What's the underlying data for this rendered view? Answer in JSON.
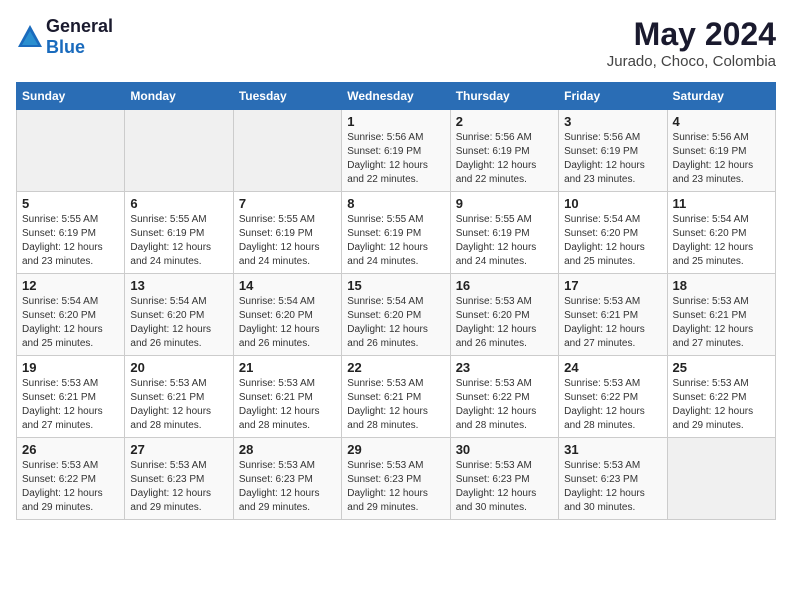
{
  "header": {
    "logo_general": "General",
    "logo_blue": "Blue",
    "month_year": "May 2024",
    "location": "Jurado, Choco, Colombia"
  },
  "days_of_week": [
    "Sunday",
    "Monday",
    "Tuesday",
    "Wednesday",
    "Thursday",
    "Friday",
    "Saturday"
  ],
  "weeks": [
    [
      {
        "day": "",
        "info": ""
      },
      {
        "day": "",
        "info": ""
      },
      {
        "day": "",
        "info": ""
      },
      {
        "day": "1",
        "info": "Sunrise: 5:56 AM\nSunset: 6:19 PM\nDaylight: 12 hours\nand 22 minutes."
      },
      {
        "day": "2",
        "info": "Sunrise: 5:56 AM\nSunset: 6:19 PM\nDaylight: 12 hours\nand 22 minutes."
      },
      {
        "day": "3",
        "info": "Sunrise: 5:56 AM\nSunset: 6:19 PM\nDaylight: 12 hours\nand 23 minutes."
      },
      {
        "day": "4",
        "info": "Sunrise: 5:56 AM\nSunset: 6:19 PM\nDaylight: 12 hours\nand 23 minutes."
      }
    ],
    [
      {
        "day": "5",
        "info": "Sunrise: 5:55 AM\nSunset: 6:19 PM\nDaylight: 12 hours\nand 23 minutes."
      },
      {
        "day": "6",
        "info": "Sunrise: 5:55 AM\nSunset: 6:19 PM\nDaylight: 12 hours\nand 24 minutes."
      },
      {
        "day": "7",
        "info": "Sunrise: 5:55 AM\nSunset: 6:19 PM\nDaylight: 12 hours\nand 24 minutes."
      },
      {
        "day": "8",
        "info": "Sunrise: 5:55 AM\nSunset: 6:19 PM\nDaylight: 12 hours\nand 24 minutes."
      },
      {
        "day": "9",
        "info": "Sunrise: 5:55 AM\nSunset: 6:19 PM\nDaylight: 12 hours\nand 24 minutes."
      },
      {
        "day": "10",
        "info": "Sunrise: 5:54 AM\nSunset: 6:20 PM\nDaylight: 12 hours\nand 25 minutes."
      },
      {
        "day": "11",
        "info": "Sunrise: 5:54 AM\nSunset: 6:20 PM\nDaylight: 12 hours\nand 25 minutes."
      }
    ],
    [
      {
        "day": "12",
        "info": "Sunrise: 5:54 AM\nSunset: 6:20 PM\nDaylight: 12 hours\nand 25 minutes."
      },
      {
        "day": "13",
        "info": "Sunrise: 5:54 AM\nSunset: 6:20 PM\nDaylight: 12 hours\nand 26 minutes."
      },
      {
        "day": "14",
        "info": "Sunrise: 5:54 AM\nSunset: 6:20 PM\nDaylight: 12 hours\nand 26 minutes."
      },
      {
        "day": "15",
        "info": "Sunrise: 5:54 AM\nSunset: 6:20 PM\nDaylight: 12 hours\nand 26 minutes."
      },
      {
        "day": "16",
        "info": "Sunrise: 5:53 AM\nSunset: 6:20 PM\nDaylight: 12 hours\nand 26 minutes."
      },
      {
        "day": "17",
        "info": "Sunrise: 5:53 AM\nSunset: 6:21 PM\nDaylight: 12 hours\nand 27 minutes."
      },
      {
        "day": "18",
        "info": "Sunrise: 5:53 AM\nSunset: 6:21 PM\nDaylight: 12 hours\nand 27 minutes."
      }
    ],
    [
      {
        "day": "19",
        "info": "Sunrise: 5:53 AM\nSunset: 6:21 PM\nDaylight: 12 hours\nand 27 minutes."
      },
      {
        "day": "20",
        "info": "Sunrise: 5:53 AM\nSunset: 6:21 PM\nDaylight: 12 hours\nand 28 minutes."
      },
      {
        "day": "21",
        "info": "Sunrise: 5:53 AM\nSunset: 6:21 PM\nDaylight: 12 hours\nand 28 minutes."
      },
      {
        "day": "22",
        "info": "Sunrise: 5:53 AM\nSunset: 6:21 PM\nDaylight: 12 hours\nand 28 minutes."
      },
      {
        "day": "23",
        "info": "Sunrise: 5:53 AM\nSunset: 6:22 PM\nDaylight: 12 hours\nand 28 minutes."
      },
      {
        "day": "24",
        "info": "Sunrise: 5:53 AM\nSunset: 6:22 PM\nDaylight: 12 hours\nand 28 minutes."
      },
      {
        "day": "25",
        "info": "Sunrise: 5:53 AM\nSunset: 6:22 PM\nDaylight: 12 hours\nand 29 minutes."
      }
    ],
    [
      {
        "day": "26",
        "info": "Sunrise: 5:53 AM\nSunset: 6:22 PM\nDaylight: 12 hours\nand 29 minutes."
      },
      {
        "day": "27",
        "info": "Sunrise: 5:53 AM\nSunset: 6:23 PM\nDaylight: 12 hours\nand 29 minutes."
      },
      {
        "day": "28",
        "info": "Sunrise: 5:53 AM\nSunset: 6:23 PM\nDaylight: 12 hours\nand 29 minutes."
      },
      {
        "day": "29",
        "info": "Sunrise: 5:53 AM\nSunset: 6:23 PM\nDaylight: 12 hours\nand 29 minutes."
      },
      {
        "day": "30",
        "info": "Sunrise: 5:53 AM\nSunset: 6:23 PM\nDaylight: 12 hours\nand 30 minutes."
      },
      {
        "day": "31",
        "info": "Sunrise: 5:53 AM\nSunset: 6:23 PM\nDaylight: 12 hours\nand 30 minutes."
      },
      {
        "day": "",
        "info": ""
      }
    ]
  ]
}
